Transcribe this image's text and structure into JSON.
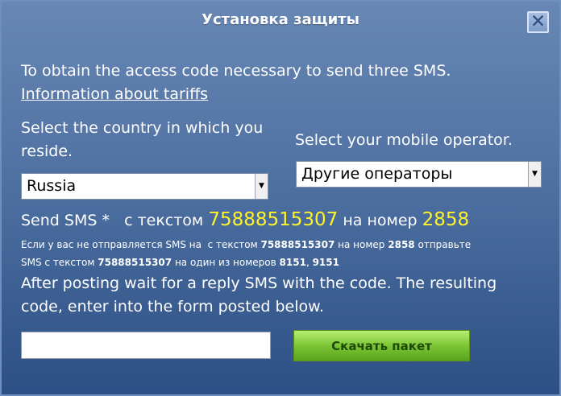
{
  "dialog": {
    "title": "Установка защиты",
    "intro": "To obtain the access code necessary to send three SMS.",
    "tariff_link": "Information about tariffs",
    "country_prompt": "Select the country in which you reside.",
    "operator_prompt": "Select your mobile operator.",
    "country_value": "Russia",
    "operator_value": "Другие операторы",
    "sms": {
      "prefix": "Send SMS *",
      "with_text": "с текстом",
      "code": "75888515307",
      "to_number": "на номер",
      "number": "2858",
      "fallback_1": "Если у вас не отправляется SMS на",
      "fallback_2": "с текстом",
      "fallback_3": "на номер",
      "fallback_4": "отправьте",
      "fallback_5": "SMS с текстом",
      "fallback_6": "на один из номеров",
      "alt_number_1": "8151",
      "alt_number_2": "9151"
    },
    "instruction": "After posting wait for a reply SMS with the code. The resulting code, enter into the form posted below.",
    "button_label": "Скачать пакет",
    "close_glyph": "✕"
  }
}
